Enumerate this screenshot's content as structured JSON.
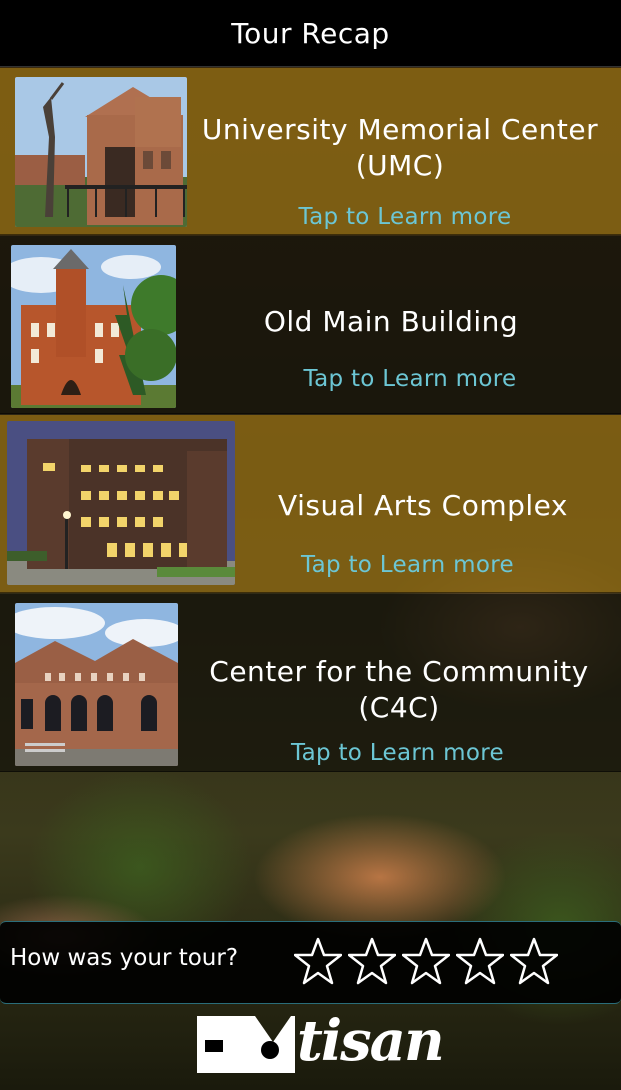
{
  "header": {
    "title": "Tour Recap"
  },
  "stops": [
    {
      "name": "University Memorial Center (UMC)",
      "line1": "University Memorial Center",
      "line2": "(UMC)",
      "link": "Tap to Learn more"
    },
    {
      "name": "Old Main Building",
      "line1": "Old Main Building",
      "line2": "",
      "link": "Tap to Learn more"
    },
    {
      "name": "Visual Arts Complex",
      "line1": "Visual Arts Complex",
      "line2": "",
      "link": "Tap to Learn more"
    },
    {
      "name": "Center for the Community (C4C)",
      "line1": "Center for the Community",
      "line2": "(C4C)",
      "link": "Tap to Learn more"
    }
  ],
  "rating": {
    "question": "How was your tour?",
    "stars_total": 5,
    "stars_selected": 0
  },
  "logo": {
    "text": "tisan"
  },
  "colors": {
    "link": "#6cc6d4",
    "gold_card": "#8c6914",
    "accent_border": "#2a6d7a"
  }
}
